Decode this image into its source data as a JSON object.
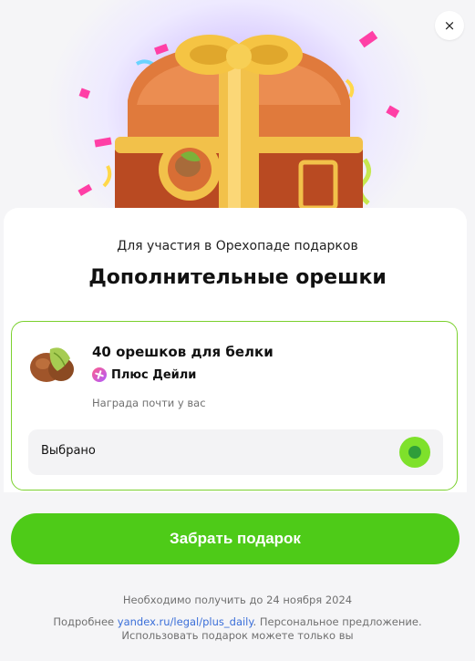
{
  "dialog": {
    "close_label": "×",
    "subtitle": "Для участия в Орехопаде подарков",
    "title": "Дополнительные орешки"
  },
  "offer": {
    "name": "40 орешков для белки",
    "brand": "Плюс Дейли",
    "brand_icon": "plus-daily-icon",
    "reward_note": "Награда почти у вас",
    "selected_label": "Выбрано",
    "selected": true
  },
  "actions": {
    "claim_label": "Забрать подарок"
  },
  "footer": {
    "deadline": "Необходимо получить до 24 ноября 2024",
    "details_prefix": "Подробнее ",
    "details_link": "yandex.ru/legal/plus_daily",
    "details_suffix": ". Персональное предложение. Использовать подарок можете только вы"
  },
  "colors": {
    "accent_green": "#4ecb18",
    "border_green": "#7bd12e",
    "link_blue": "#3b6fd9",
    "hero_purple": "#c9b6ff"
  }
}
